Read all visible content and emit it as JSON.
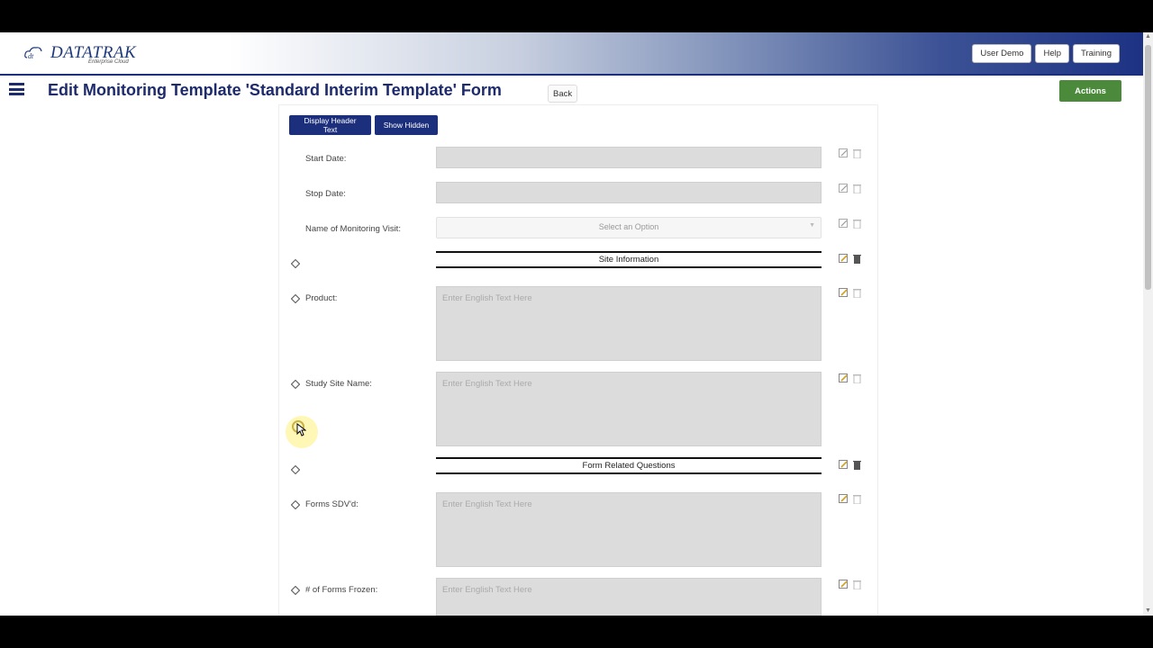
{
  "header": {
    "logo_text": "DATATRAK",
    "logo_sub": "Enterprise Cloud",
    "buttons": [
      "User Demo",
      "Help",
      "Training"
    ],
    "gradient_end_color": "#1d3283"
  },
  "page": {
    "title": "Edit Monitoring Template 'Standard Interim Template' Form",
    "back_label": "Back",
    "actions_label": "Actions",
    "actions_color": "#4a8a3a"
  },
  "toolbar": {
    "display_header_text": "Display Header Text",
    "show_hidden": "Show Hidden"
  },
  "fields": {
    "start_date": "Start Date:",
    "stop_date": "Stop Date:",
    "visit_name": "Name of Monitoring Visit:",
    "visit_placeholder": "Select an Option",
    "site_info_section": "Site Information",
    "product": "Product:",
    "study_site_name": "Study Site Name:",
    "form_questions_section": "Form Related Questions",
    "forms_sdvd": "Forms SDV'd:",
    "forms_frozen": "# of Forms Frozen:",
    "text_placeholder": "Enter English Text Here"
  },
  "icons": {
    "edit": "pencil-icon",
    "delete": "trash-icon",
    "reorder": "diamond-reorder-icon"
  }
}
